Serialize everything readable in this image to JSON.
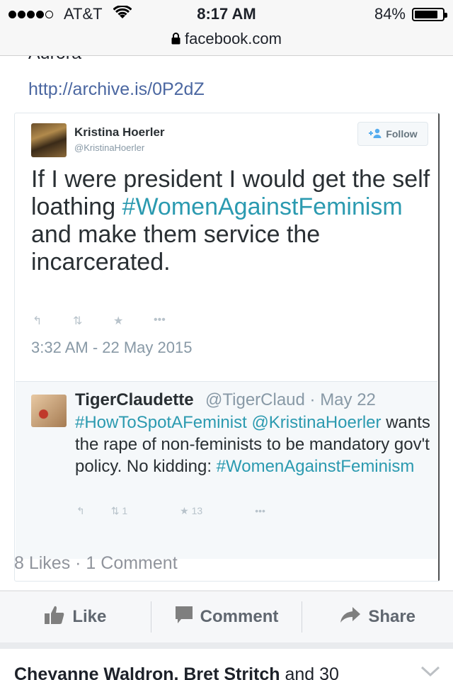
{
  "status_bar": {
    "carrier": "AT&T",
    "time": "8:17 AM",
    "battery": "84%",
    "battery_level": 0.84
  },
  "browser": {
    "url": "facebook.com"
  },
  "post": {
    "text_cut": "Aurora",
    "link": "http://archive.is/0P2dZ",
    "likes_summary": "8 Likes · 1 Comment"
  },
  "tweet": {
    "author_name": "Kristina Hoerler",
    "author_handle": "@KristinaHoerler",
    "follow_label": "Follow",
    "text_before": "If I were president I would get the self loathing ",
    "hashtag": "#WomenAgainstFeminism",
    "text_after": " and make them service the incarcerated.",
    "date": "3:32 AM - 22 May 2015"
  },
  "quoted": {
    "name": "TigerClaudette",
    "meta": "@TigerClaud · May 22",
    "hashtag1": "#HowToSpotAFeminist",
    "mention": "@KristinaHoerler",
    "text": "wants the rape of non-feminists to be mandatory gov't policy. No kidding:",
    "hashtag2": "#WomenAgainstFeminism",
    "retweets": "1",
    "favorites": "13"
  },
  "actions": {
    "like": "Like",
    "comment": "Comment",
    "share": "Share"
  },
  "comments": {
    "names": "Cheyanne Waldron, Bret Stritch",
    "suffix": " and 30"
  }
}
